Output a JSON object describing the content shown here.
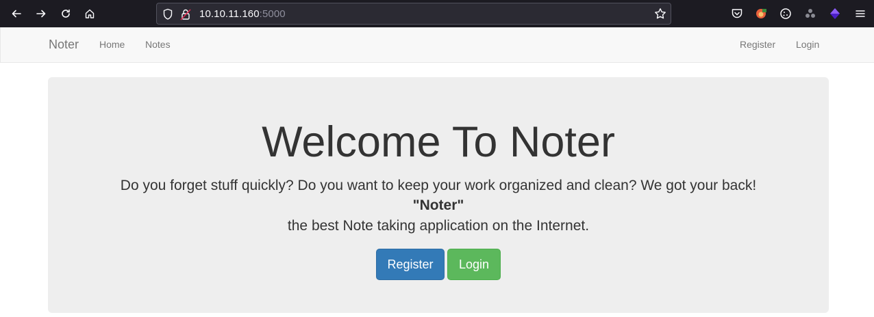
{
  "browser": {
    "url_host": "10.10.11.160",
    "url_port": ":5000",
    "icons": [
      "back-arrow-icon",
      "forward-arrow-icon",
      "reload-icon",
      "home-icon",
      "shield-icon",
      "insecure-lock-icon",
      "bookmark-star-icon",
      "pocket-icon",
      "foxyproxy-icon",
      "cookie-icon",
      "extension-icon",
      "wappalyzer-icon",
      "menu-icon"
    ]
  },
  "navbar": {
    "brand": "Noter",
    "left_links": [
      "Home",
      "Notes"
    ],
    "right_links": [
      "Register",
      "Login"
    ]
  },
  "hero": {
    "title": "Welcome To Noter",
    "line1": "Do you forget stuff quickly? Do you want to keep your work organized and clean? We got your back!",
    "line2": "\"Noter\"",
    "line3": "the best Note taking application on the Internet.",
    "register_label": "Register",
    "login_label": "Login"
  },
  "colors": {
    "primary": "#337ab7",
    "success": "#5cb85c",
    "jumbotron": "#eeeeee"
  }
}
